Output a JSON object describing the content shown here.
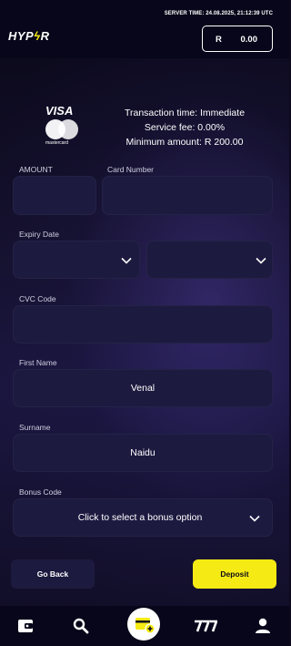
{
  "header": {
    "server_time": "SERVER TIME: 24.08.2025, 21:12:39 UTC",
    "logo_main": "HYP",
    "logo_bolt": "ϟ",
    "logo_tail": "R",
    "balance_currency": "R",
    "balance_amount": "0.00"
  },
  "payment": {
    "visa": "VISA",
    "mastercard": "mastercard",
    "transaction_time": "Transaction time: Immediate",
    "service_fee": "Service fee: 0.00%",
    "minimum_amount": "Minimum amount: R 200.00"
  },
  "form": {
    "amount_label": "AMOUNT",
    "amount_value": "",
    "card_number_label": "Card Number",
    "card_number_value": "",
    "expiry_label": "Expiry Date",
    "expiry_month": "",
    "expiry_year": "",
    "cvc_label": "CVC Code",
    "cvc_value": "",
    "first_name_label": "First Name",
    "first_name_value": "Venal",
    "surname_label": "Surname",
    "surname_value": "Naidu",
    "bonus_label": "Bonus Code",
    "bonus_value": "Click to select a bonus option"
  },
  "actions": {
    "back_label": "Go Back",
    "deposit_label": "Deposit"
  },
  "nav": {
    "items": [
      "wallet-icon",
      "search-icon",
      "cashier-icon",
      "slots-777-icon",
      "profile-icon"
    ]
  },
  "colors": {
    "accent": "#f6ea14",
    "field_bg": "#1d1a40",
    "bar_bg": "#07061a"
  }
}
